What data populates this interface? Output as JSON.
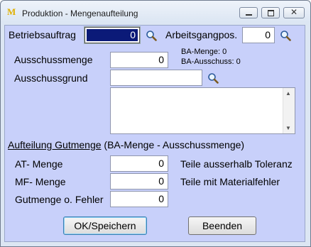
{
  "window": {
    "title": "Produktion - Mengenaufteilung",
    "logo_text": "M",
    "close_glyph": "✕"
  },
  "header": {
    "betriebsauftrag_label": "Betriebsauftrag",
    "betriebsauftrag_value": "0",
    "arbeitsgangpos_label": "Arbeitsgangpos.",
    "arbeitsgangpos_value": "0"
  },
  "ausschuss": {
    "menge_label": "Ausschussmenge",
    "menge_value": "0",
    "ba_menge_info": "BA-Menge: 0",
    "ba_ausschuss_info": "BA-Ausschuss: 0",
    "grund_label": "Ausschussgrund",
    "grund_value": "",
    "grund_text": ""
  },
  "aufteilung": {
    "title_underlined": "Aufteilung Gutmenge",
    "title_rest": " (BA-Menge - Ausschussmenge)",
    "rows": [
      {
        "label": "AT- Menge",
        "value": "0",
        "note": "Teile ausserhalb Toleranz"
      },
      {
        "label": "MF- Menge",
        "value": "0",
        "note": "Teile mit Materialfehler"
      },
      {
        "label": "Gutmenge o. Fehler",
        "value": "0",
        "note": ""
      }
    ]
  },
  "buttons": {
    "ok_label": "OK/Speichern",
    "beenden_label": "Beenden"
  },
  "icons": {
    "search": "magnifier-icon",
    "scroll_up": "▲",
    "scroll_down": "▼"
  }
}
